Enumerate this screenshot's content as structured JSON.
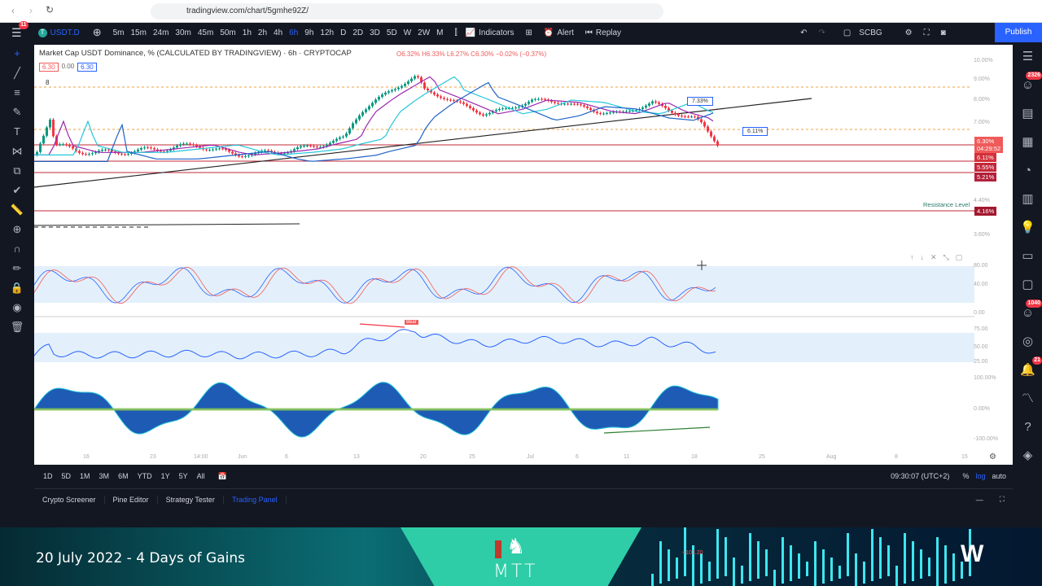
{
  "browser": {
    "url": "tradingview.com/chart/5gmhe92Z/"
  },
  "topbar": {
    "menu_badge": "11",
    "symbol": "USDT.D",
    "timeframes": [
      "5m",
      "15m",
      "24m",
      "30m",
      "45m",
      "50m",
      "1h",
      "2h",
      "4h",
      "6h",
      "9h",
      "12h",
      "D",
      "2D",
      "3D",
      "5D",
      "W",
      "2W",
      "M"
    ],
    "active_timeframe": "6h",
    "indicators": "Indicators",
    "alert": "Alert",
    "replay": "Replay",
    "layout": "SCBG",
    "publish": "Publish"
  },
  "legend": {
    "title": "Market Cap USDT Dominance, % (CALCULATED BY TRADINGVIEW) · 6h · CRYPTOCAP",
    "ohlc": "O6.32% H6.33% L6.27% C6.30% −0.02% (−0.37%)",
    "bid": "6.30",
    "spread": "0.00",
    "ask": "6.30",
    "count": "8"
  },
  "price_axis": {
    "ticks": [
      "10.00%",
      "9.00%",
      "8.00%",
      "7.00%",
      "4.40%",
      "4.00%",
      "3.60%"
    ],
    "labels": [
      {
        "value": "6.30%",
        "sub": "04:29:52",
        "color": "#f05a5a"
      },
      {
        "value": "6.11%",
        "color": "#d3303a"
      },
      {
        "value": "5.55%",
        "color": "#c3283a"
      },
      {
        "value": "5.21%",
        "color": "#b3203a"
      },
      {
        "value": "4.16%",
        "color": "#a3182e"
      }
    ]
  },
  "annotations": {
    "callout1": "7.33%",
    "callout2": "6.11%",
    "resistance": "Resistance Level",
    "bear": "Bear"
  },
  "osc_axes": {
    "stoch": [
      "80.00",
      "40.00",
      "0.00"
    ],
    "rsi": [
      "75.00",
      "50.00",
      "25.00"
    ],
    "macd": [
      "100.00%",
      "0.00%",
      "-100.00%"
    ]
  },
  "time_axis": [
    "16",
    "23",
    "14:00",
    "Jun",
    "6",
    "13",
    "20",
    "25",
    "Jul",
    "6",
    "11",
    "18",
    "25",
    "Aug",
    "8",
    "15"
  ],
  "bottombar": {
    "ranges": [
      "1D",
      "5D",
      "1M",
      "3M",
      "6M",
      "YTD",
      "1Y",
      "5Y",
      "All"
    ],
    "clock": "09:30:07 (UTC+2)",
    "pct": "%",
    "log": "log",
    "auto": "auto"
  },
  "panel": {
    "tabs": [
      "Crypto Screener",
      "Pine Editor",
      "Strategy Tester",
      "Trading Panel"
    ],
    "active": "Trading Panel"
  },
  "rightbar": {
    "badge1": "2326",
    "badge2": "1040",
    "badge3": "21"
  },
  "banner": {
    "title": "20 July 2022 - 4 Days of Gains",
    "logo": "MTT",
    "ticker": "+103.20"
  },
  "colors": {
    "accent": "#2962ff",
    "down": "#f23645",
    "up": "#089981",
    "banner_green": "#2ecda7"
  }
}
